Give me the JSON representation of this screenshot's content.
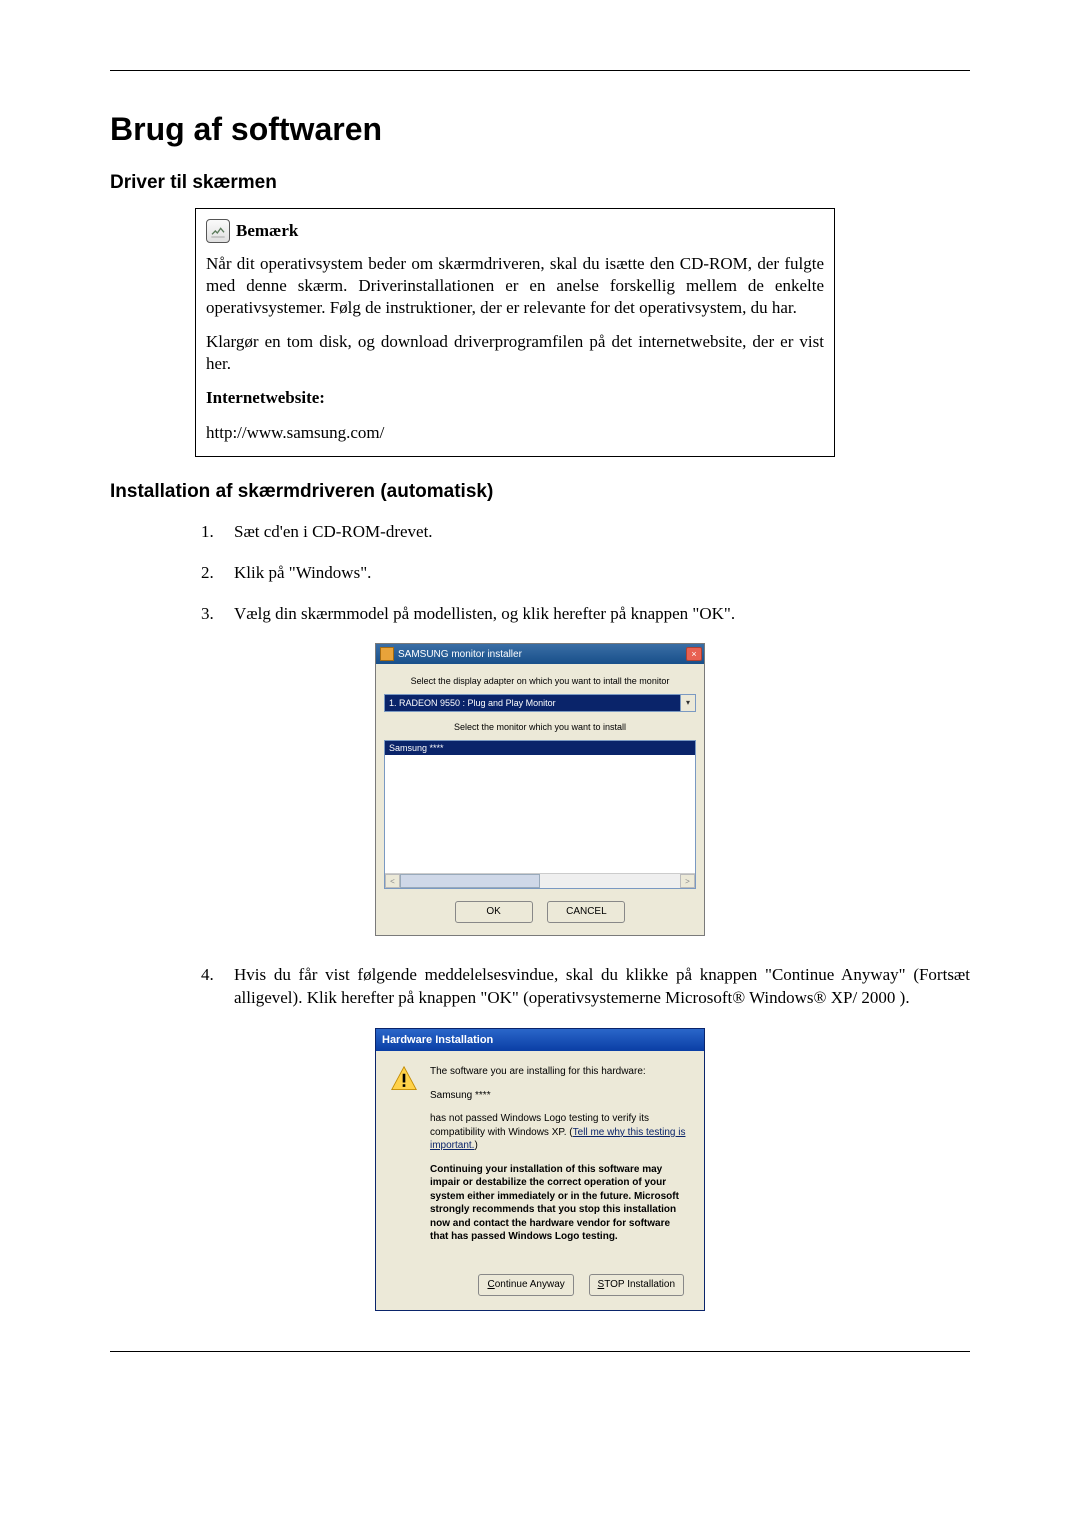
{
  "page_title": "Brug af softwaren",
  "section_driver_heading": "Driver til skærmen",
  "note": {
    "title": "Bemærk",
    "para1": "Når dit operativsystem beder om skærmdriveren, skal du isætte den CD-ROM, der fulgte med denne skærm. Driverinstallationen er en anelse forskellig mellem de enkelte operativsystemer. Følg de instruktioner, der er relevante for det operativsystem, du har.",
    "para2": "Klargør en tom disk, og download driverprogramfilen på det internetwebsite, der er vist her.",
    "website_label": "Internetwebsite:",
    "url": "http://www.samsung.com/"
  },
  "section_install_heading": "Installation af skærmdriveren (automatisk)",
  "steps": {
    "s1": "Sæt cd'en i CD-ROM-drevet.",
    "s2": "Klik på \"Windows\".",
    "s3": "Vælg din skærmmodel på modellisten, og klik herefter på knappen \"OK\".",
    "s4": "Hvis du får vist følgende meddelelsesvindue, skal du klikke på knappen \"Continue Anyway\" (Fortsæt alligevel). Klik herefter på knappen \"OK\" (operativsystemerne Microsoft® Windows® XP/ 2000 )."
  },
  "dlg1": {
    "title": "SAMSUNG monitor installer",
    "label1": "Select the display adapter on which you want to intall the monitor",
    "select_value": "1. RADEON 9550 : Plug and Play Monitor",
    "label2": "Select the monitor which you want to install",
    "list_selected": "Samsung ****",
    "btn_ok": "OK",
    "btn_cancel": "CANCEL"
  },
  "dlg2": {
    "title": "Hardware Installation",
    "line1": "The software you are installing for this hardware:",
    "line2": "Samsung ****",
    "line3_a": "has not passed Windows Logo testing to verify its compatibility with Windows XP. (",
    "line3_link": "Tell me why this testing is important.",
    "line3_b": ")",
    "bold": "Continuing your installation of this software may impair or destabilize the correct operation of your system either immediately or in the future. Microsoft strongly recommends that you stop this installation now and contact the hardware vendor for software that has passed Windows Logo testing.",
    "btn_continue": "Continue Anyway",
    "btn_stop": "STOP Installation"
  }
}
